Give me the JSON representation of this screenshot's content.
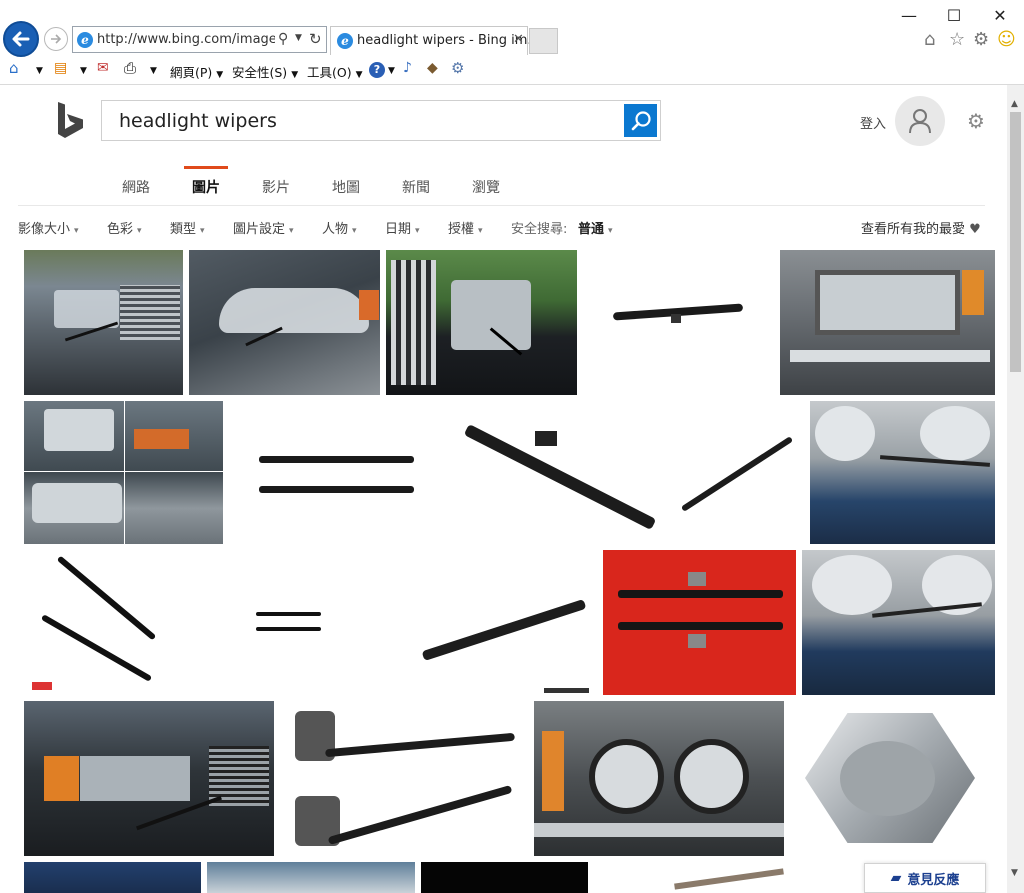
{
  "browser": {
    "address_url": "http://www.bing.com/images/s",
    "tab_title": "headlight wipers - Bing im...",
    "command_bar": {
      "page_menu": "網頁(P)",
      "safety_menu": "安全性(S)",
      "tools_menu": "工具(O)"
    }
  },
  "bing": {
    "search_query": "headlight wipers",
    "login_label": "登入",
    "nav_tabs": [
      {
        "label": "網路"
      },
      {
        "label": "圖片"
      },
      {
        "label": "影片"
      },
      {
        "label": "地圖"
      },
      {
        "label": "新聞"
      },
      {
        "label": "瀏覽"
      }
    ],
    "filters": {
      "image_size": "影像大小",
      "color": "色彩",
      "type": "類型",
      "layout": "圖片設定",
      "people": "人物",
      "date": "日期",
      "license": "授權",
      "safe_search_label": "安全搜尋:",
      "safe_search_value": "普通",
      "favorites": "查看所有我的最愛"
    },
    "feedback_label": "意見反應",
    "colors": {
      "accent": "#e04a1b",
      "search_button": "#0b78d0",
      "ie_blue": "#1a5fb4"
    }
  }
}
